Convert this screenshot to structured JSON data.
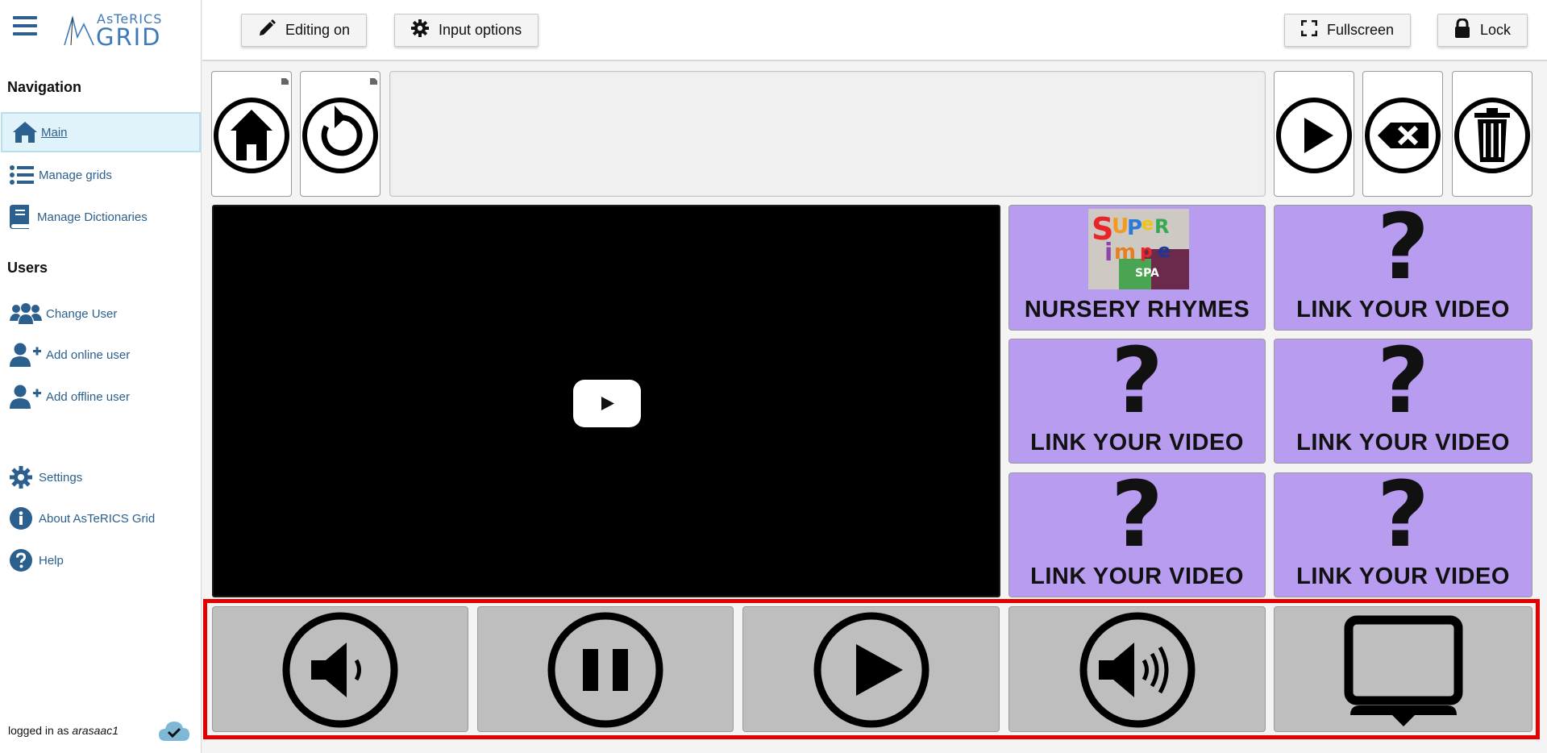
{
  "app": {
    "logo_top": "AsTeRICS",
    "logo_bottom": "GRID"
  },
  "sidebar": {
    "navigation_title": "Navigation",
    "navigation_items": [
      {
        "label": "Main",
        "icon": "home-icon",
        "active": true
      },
      {
        "label": "Manage grids",
        "icon": "list-icon"
      },
      {
        "label": "Manage Dictionaries",
        "icon": "book-icon"
      }
    ],
    "users_title": "Users",
    "user_items": [
      {
        "label": "Change User",
        "icon": "users-icon"
      },
      {
        "label": "Add online user",
        "icon": "user-plus-icon"
      },
      {
        "label": "Add offline user",
        "icon": "user-plus-icon"
      }
    ],
    "other_items": [
      {
        "label": "Settings",
        "icon": "gear-icon"
      },
      {
        "label": "About AsTeRICS Grid",
        "icon": "info-icon"
      },
      {
        "label": "Help",
        "icon": "question-icon"
      }
    ],
    "footer": {
      "logged_in_prefix": "logged in as",
      "username": "arasaac1",
      "sync_icon": "cloud-check-icon"
    }
  },
  "toolbar": {
    "editing_label": "Editing on",
    "input_options_label": "Input options",
    "fullscreen_label": "Fullscreen",
    "lock_label": "Lock"
  },
  "grid": {
    "top_row": [
      {
        "name": "home",
        "icon": "home-circle-icon"
      },
      {
        "name": "back",
        "icon": "undo-circle-icon"
      },
      {
        "name": "speak",
        "icon": "play-circle-icon"
      },
      {
        "name": "backspace",
        "icon": "backspace-circle-icon"
      },
      {
        "name": "clear",
        "icon": "trash-circle-icon"
      }
    ],
    "video_cells": [
      {
        "label": "NURSERY RHYMES",
        "image": "super-simple-thumbnail"
      },
      {
        "label": "LINK YOUR VIDEO",
        "icon": "question-mark"
      },
      {
        "label": "LINK YOUR VIDEO",
        "icon": "question-mark"
      },
      {
        "label": "LINK YOUR VIDEO",
        "icon": "question-mark"
      },
      {
        "label": "LINK YOUR VIDEO",
        "icon": "question-mark"
      },
      {
        "label": "LINK YOUR VIDEO",
        "icon": "question-mark"
      }
    ],
    "thumbnail_text": {
      "row1": "SUPER",
      "row2": "SIMPLE",
      "row3": "ESPAÑOL"
    },
    "question_mark": "?",
    "controls": [
      {
        "name": "volume-down",
        "icon": "volume-down-circle-icon"
      },
      {
        "name": "pause",
        "icon": "pause-circle-icon"
      },
      {
        "name": "play",
        "icon": "play-circle-icon"
      },
      {
        "name": "volume-up",
        "icon": "volume-up-circle-icon"
      },
      {
        "name": "fullscreen-screen",
        "icon": "monitor-icon"
      }
    ]
  },
  "colors": {
    "accent": "#2b5f8d",
    "cell_purple": "#b79cf0",
    "cell_gray": "#bebebe",
    "highlight": "#e40000"
  }
}
